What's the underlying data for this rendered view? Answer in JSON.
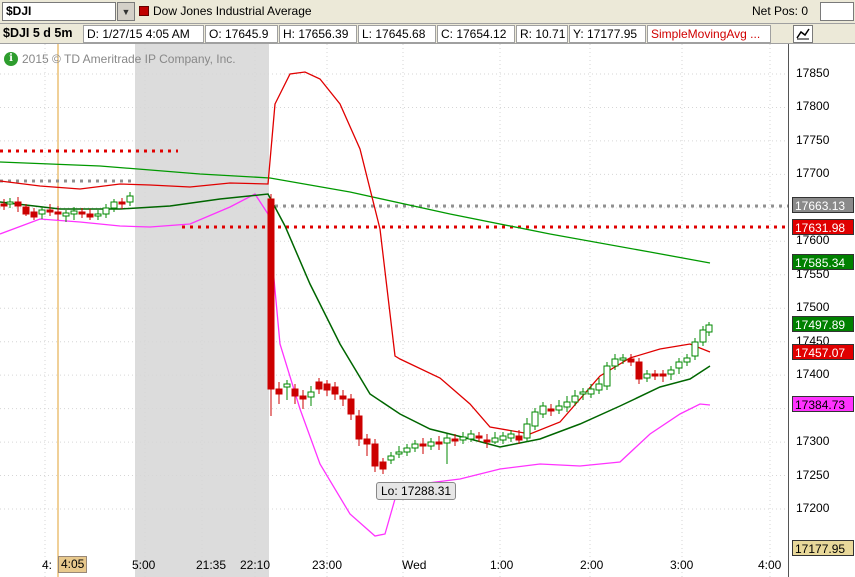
{
  "toolbar": {
    "symbol": "$DJI",
    "description": "Dow Jones Industrial Average",
    "net_pos_label": "Net Pos: 0"
  },
  "infobar": {
    "aggregation": "$DJI 5 d 5m",
    "date": "D: 1/27/15 4:05 AM",
    "open": "O: 17645.9",
    "high": "H: 17656.39",
    "low": "L: 17645.68",
    "close": "C: 17654.12",
    "range": "R: 10.71",
    "y": "Y: 17177.95",
    "study": "SimpleMovingAvg ..."
  },
  "copyright": "2015 © TD Ameritrade IP Company, Inc.",
  "y_axis": {
    "ticks": [
      "17850",
      "17800",
      "17750",
      "17700",
      "17650",
      "17600",
      "17550",
      "17500",
      "17450",
      "17400",
      "17350",
      "17300",
      "17250",
      "17200"
    ],
    "price_tags": [
      {
        "label": "17663.13",
        "color": "#808080"
      },
      {
        "label": "17631.98",
        "color": "#e00000"
      },
      {
        "label": "17585.34",
        "color": "#008000"
      },
      {
        "label": "17497.89",
        "color": "#008000"
      },
      {
        "label": "17457.07",
        "color": "#e00000"
      },
      {
        "label": "17384.73",
        "color": "#ff33ff"
      },
      {
        "label": "17177.95",
        "color": "#808000"
      }
    ]
  },
  "x_axis": {
    "labels": [
      "4:",
      "5:00",
      "21:35",
      "22:10",
      "23:00",
      "Wed",
      "1:00",
      "2:00",
      "3:00",
      "4:00"
    ],
    "cursor_tag": "4:05"
  },
  "low_label": "Lo: 17288.31",
  "colors": {
    "upper_band": "#e00000",
    "lower_band": "#ff33ff",
    "sma": "#006600",
    "long_sma": "#009900",
    "candle_up": "#008800",
    "candle_down": "#cc0000"
  }
}
